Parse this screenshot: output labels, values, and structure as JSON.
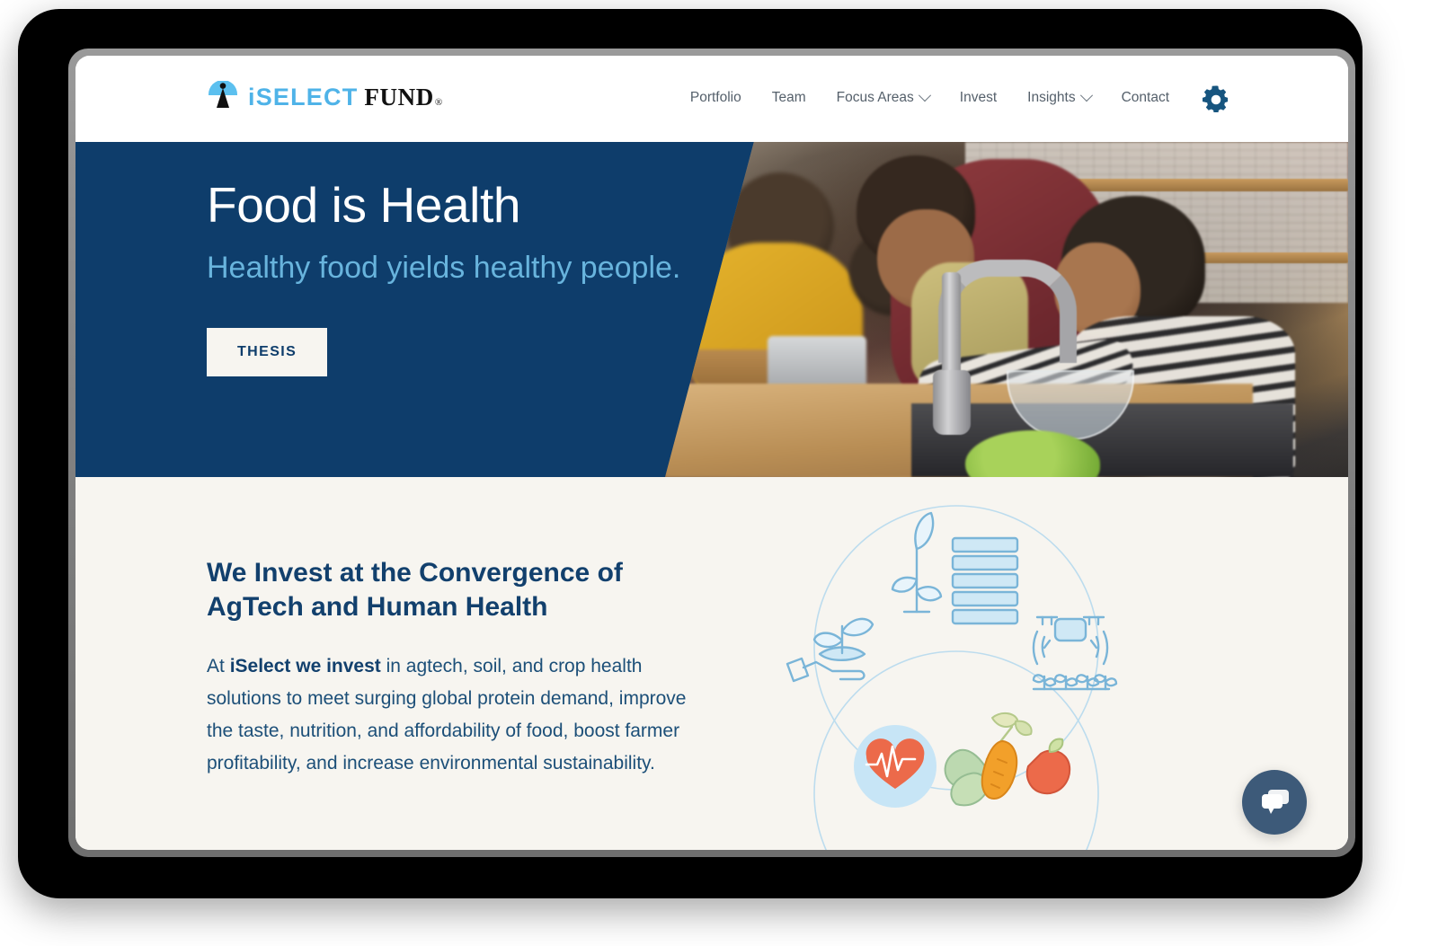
{
  "brand": {
    "logo_iselect": "iSELECT",
    "logo_fund": "FUND",
    "logo_registered": "®",
    "logo_mark_icon": "iselect-logo-mark"
  },
  "nav": {
    "items": [
      {
        "label": "Portfolio",
        "has_dropdown": false
      },
      {
        "label": "Team",
        "has_dropdown": false
      },
      {
        "label": "Focus Areas",
        "has_dropdown": true
      },
      {
        "label": "Invest",
        "has_dropdown": false
      },
      {
        "label": "Insights",
        "has_dropdown": true
      },
      {
        "label": "Contact",
        "has_dropdown": false
      }
    ],
    "settings_icon": "gear-icon"
  },
  "hero": {
    "title": "Food is Health",
    "subtitle": "Healthy food yields healthy people.",
    "cta_label": "THESIS",
    "photo_alt": "family-cooking-in-kitchen-photo"
  },
  "section": {
    "heading": "We Invest at the Convergence of AgTech and Human Health",
    "body_lead": "At ",
    "body_bold": "iSelect we invest",
    "body_rest": " in agtech, soil, and crop health solutions to meet surging global protein demand, improve the taste, nutrition, and affordability of food, boost farmer profitability, and increase environmental sustainability.",
    "illustration": {
      "name": "venn-diagram-illustration",
      "icons": [
        "sprout-in-hand-icon",
        "plant-data-bars-icon",
        "crop-drone-icon",
        "heart-pulse-icon",
        "vegetables-icon"
      ]
    }
  },
  "chat": {
    "icon": "chat-bubbles-icon",
    "label": "Open chat"
  },
  "colors": {
    "navy": "#0e3d6b",
    "light_blue": "#68b4dd",
    "logo_blue": "#4fb3e8",
    "cream": "#f7f5f0",
    "accent_orange": "#ec6a4a",
    "icon_blue": "#7ab5d8",
    "chat_blue": "#3d5a79"
  }
}
